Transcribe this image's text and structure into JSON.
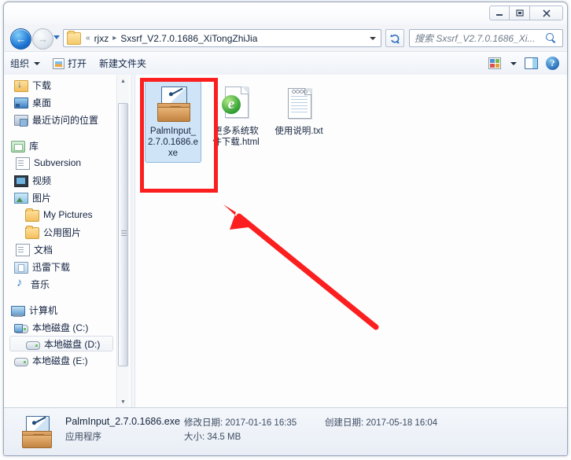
{
  "window": {
    "controls": {
      "minimize": "—",
      "maximize": "❐",
      "close": "✕"
    }
  },
  "nav": {
    "back_icon": "back-arrow-icon",
    "forward_icon": "forward-arrow-icon",
    "history_dropdown": "history-dropdown-icon",
    "breadcrumb": {
      "overflow": "«",
      "parent": "rjxz",
      "separator": "▸",
      "current": "Sxsrf_V2.7.0.1686_XiTongZhiJia"
    },
    "refresh_label": "↻",
    "search": {
      "placeholder": "搜索 Sxsrf_V2.7.0.1686_Xi...",
      "value": ""
    }
  },
  "toolbar": {
    "organize_label": "组织",
    "open_label": "打开",
    "new_folder_label": "新建文件夹",
    "view_icon": "view-options-icon",
    "preview_pane_icon": "preview-pane-icon",
    "help_icon": "help-icon"
  },
  "sidebar": {
    "items": [
      {
        "label": "下载",
        "icon": "download-folder-icon",
        "level": 1,
        "selected": false
      },
      {
        "label": "桌面",
        "icon": "desktop-icon",
        "level": 1,
        "selected": false
      },
      {
        "label": "最近访问的位置",
        "icon": "recent-places-icon",
        "level": 1,
        "selected": false
      },
      {
        "label": "库",
        "icon": "library-icon",
        "level": 0,
        "selected": false
      },
      {
        "label": "Subversion",
        "icon": "document-library-icon",
        "level": 1,
        "selected": false
      },
      {
        "label": "视频",
        "icon": "video-library-icon",
        "level": 1,
        "selected": false
      },
      {
        "label": "图片",
        "icon": "pictures-library-icon",
        "level": 1,
        "selected": false
      },
      {
        "label": "My Pictures",
        "icon": "folder-icon",
        "level": 2,
        "selected": false
      },
      {
        "label": "公用图片",
        "icon": "folder-icon",
        "level": 2,
        "selected": false
      },
      {
        "label": "文档",
        "icon": "documents-library-icon",
        "level": 1,
        "selected": false
      },
      {
        "label": "迅雷下载",
        "icon": "thunder-download-icon",
        "level": 1,
        "selected": false
      },
      {
        "label": "音乐",
        "icon": "music-library-icon",
        "level": 1,
        "selected": false
      },
      {
        "label": "计算机",
        "icon": "computer-icon",
        "level": 0,
        "selected": false
      },
      {
        "label": "本地磁盘 (C:)",
        "icon": "system-drive-icon",
        "level": 1,
        "selected": false
      },
      {
        "label": "本地磁盘 (D:)",
        "icon": "drive-icon",
        "level": 1,
        "selected": true
      },
      {
        "label": "本地磁盘 (E:)",
        "icon": "drive-icon",
        "level": 1,
        "selected": false
      }
    ],
    "scrollbar": {
      "up_arrow": "▲",
      "down_arrow": "▼"
    }
  },
  "files": [
    {
      "name": "PalmInput_2.7.0.1686.exe",
      "icon": "installer-package-icon",
      "selected": true
    },
    {
      "name": "更多系统软件下载.html",
      "icon": "html-page-icon",
      "selected": false
    },
    {
      "name": "使用说明.txt",
      "icon": "text-file-icon",
      "selected": false
    }
  ],
  "details": {
    "file_name": "PalmInput_2.7.0.1686.exe",
    "file_type": "应用程序",
    "modified_label": "修改日期:",
    "modified_value": "2017-01-16 16:35",
    "created_label": "创建日期:",
    "created_value": "2017-05-18 16:04",
    "size_label": "大小:",
    "size_value": "34.5 MB",
    "icon": "installer-package-icon"
  },
  "annotations": {
    "highlight_color": "#fb1f1f",
    "box": "red-highlight-box",
    "arrow": "red-pointer-arrow"
  }
}
